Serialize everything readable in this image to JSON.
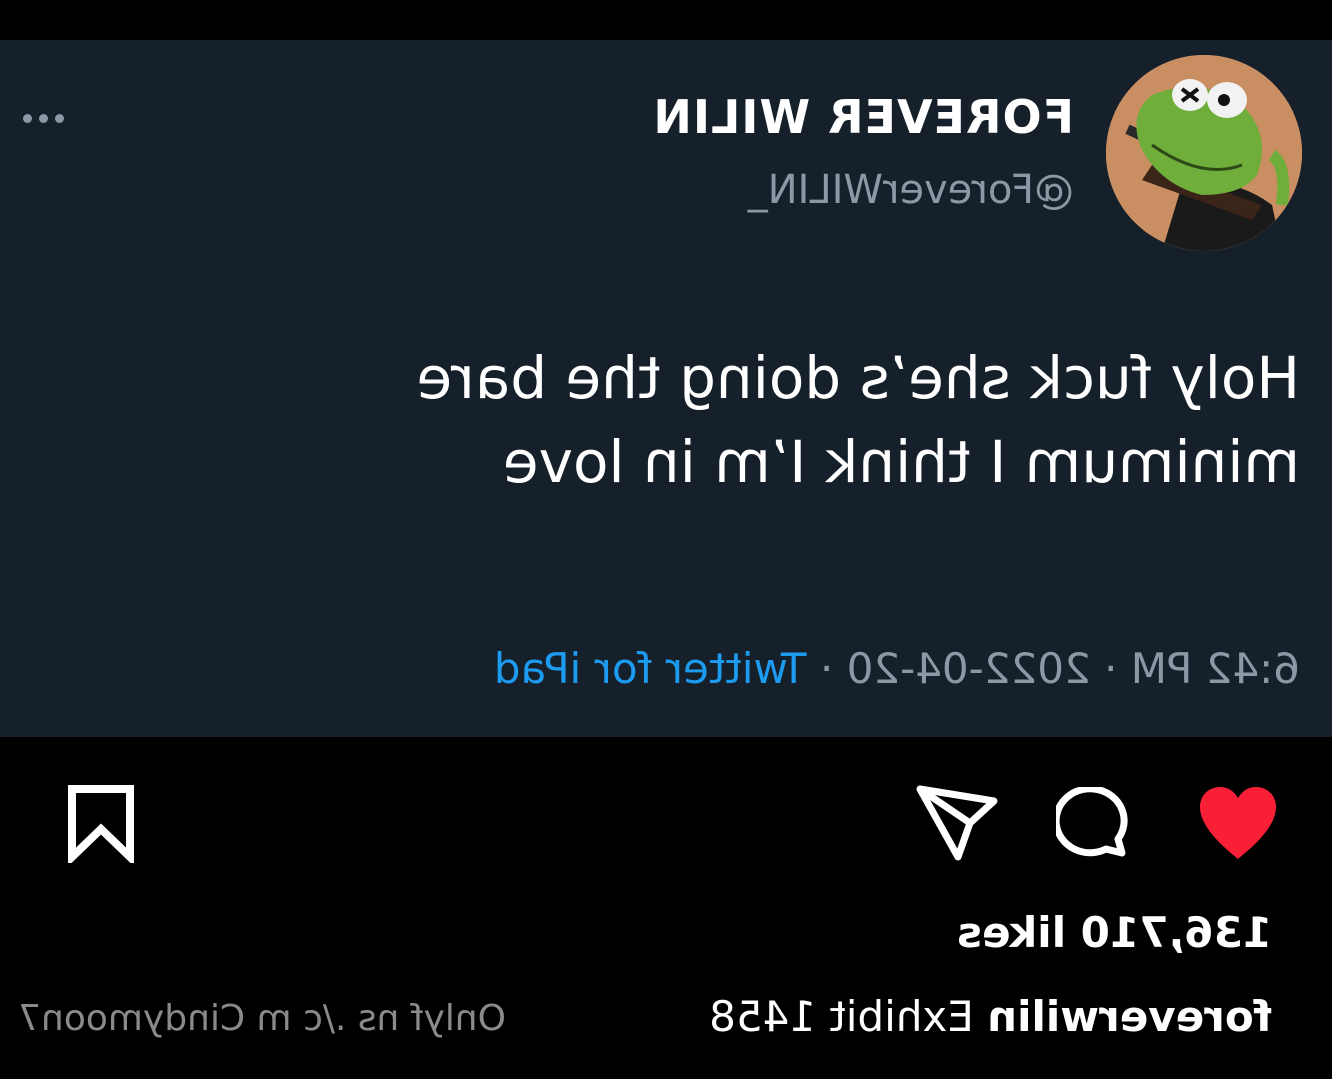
{
  "tweet": {
    "display_name": "FOREVER WILIN",
    "handle": "@ForeverWILIN_",
    "text_line1": "Holy fuck she’s doing the bare",
    "text_line2": "minimum I think I’m in love",
    "time": "6:42 PM",
    "date": "2022-04-20",
    "source": "Twitter for iPad",
    "separator": "·",
    "avatar_icon": "kermit-frog-avatar",
    "more_icon": "more-horizontal-icon"
  },
  "post": {
    "likes": "136,710 likes",
    "caption_user": "foreverwilin",
    "caption_text": "Exhibit 1458",
    "watermark": "Onlyf ns ./c m Cindymoon7"
  },
  "icons": {
    "like": "heart-filled-icon",
    "comment": "comment-bubble-icon",
    "share": "paper-plane-icon",
    "save": "bookmark-icon"
  },
  "colors": {
    "card_bg": "#15202b",
    "page_bg": "#000000",
    "secondary_text": "#8b98a5",
    "link_blue": "#1d9bf0",
    "like_red": "#f91f37"
  },
  "layout": {
    "mirrored": true
  }
}
